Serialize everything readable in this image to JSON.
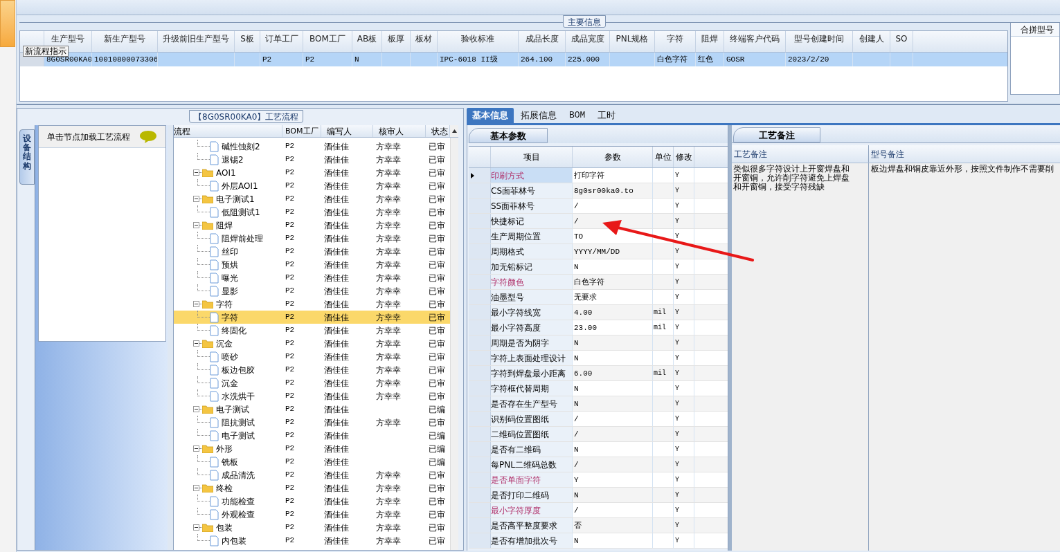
{
  "main_info": {
    "title": "主要信息",
    "columns": [
      "生产型号",
      "新生产型号",
      "升级前旧生产型号",
      "S板",
      "订单工厂",
      "BOM工厂",
      "AB板",
      "板厚",
      "板材",
      "验收标准",
      "成品长度",
      "成品宽度",
      "PNL规格",
      "字符",
      "阻焊",
      "终端客户代码",
      "型号创建时间",
      "创建人",
      "SO"
    ],
    "rows": [
      {
        "selected": true,
        "cells": [
          "8G0SR00KA0",
          "10010800073306",
          "",
          "",
          "P2",
          "P2",
          "N",
          "",
          "",
          "IPC-6018 II级",
          "264.100",
          "225.000",
          "",
          "白色字符",
          "红色",
          "GOSR",
          "2023/2/20",
          "",
          ""
        ]
      }
    ],
    "tooltip": "新流程指示",
    "side_title": "合拼型号"
  },
  "flow": {
    "title": "【8G0SR00KA0】工艺流程",
    "side_tab": "设备结构",
    "hint": "单击节点加载工艺流程",
    "columns": [
      "流程",
      "BOM工厂",
      "编写人",
      "核审人",
      "状态"
    ],
    "tree": [
      {
        "children": [
          {
            "name": "碱性蚀刻2",
            "bom": "P2",
            "writer": "酒佳佳",
            "reviewer": "方幸幸",
            "status": "已审",
            "selected": false
          },
          {
            "name": "退锡2",
            "bom": "P2",
            "writer": "酒佳佳",
            "reviewer": "方幸幸",
            "status": "已审",
            "selected": false
          }
        ]
      },
      {
        "name": "AOI1",
        "bom": "P2",
        "writer": "酒佳佳",
        "reviewer": "方幸幸",
        "status": "已审",
        "selected": false,
        "children": [
          {
            "name": "外层AOI1",
            "bom": "P2",
            "writer": "酒佳佳",
            "reviewer": "方幸幸",
            "status": "已审",
            "selected": false
          }
        ]
      },
      {
        "name": "电子测试1",
        "bom": "P2",
        "writer": "酒佳佳",
        "reviewer": "方幸幸",
        "status": "已审",
        "selected": false,
        "children": [
          {
            "name": "低阻测试1",
            "bom": "P2",
            "writer": "酒佳佳",
            "reviewer": "方幸幸",
            "status": "已审",
            "selected": false
          }
        ]
      },
      {
        "name": "阻焊",
        "bom": "P2",
        "writer": "酒佳佳",
        "reviewer": "方幸幸",
        "status": "已审",
        "selected": false,
        "children": [
          {
            "name": "阻焊前处理",
            "bom": "P2",
            "writer": "酒佳佳",
            "reviewer": "方幸幸",
            "status": "已审",
            "selected": false
          },
          {
            "name": "丝印",
            "bom": "P2",
            "writer": "酒佳佳",
            "reviewer": "方幸幸",
            "status": "已审",
            "selected": false
          },
          {
            "name": "预烘",
            "bom": "P2",
            "writer": "酒佳佳",
            "reviewer": "方幸幸",
            "status": "已审",
            "selected": false
          },
          {
            "name": "曝光",
            "bom": "P2",
            "writer": "酒佳佳",
            "reviewer": "方幸幸",
            "status": "已审",
            "selected": false
          },
          {
            "name": "显影",
            "bom": "P2",
            "writer": "酒佳佳",
            "reviewer": "方幸幸",
            "status": "已审",
            "selected": false
          }
        ]
      },
      {
        "name": "字符",
        "bom": "P2",
        "writer": "酒佳佳",
        "reviewer": "方幸幸",
        "status": "已审",
        "selected": false,
        "children": [
          {
            "name": "字符",
            "bom": "P2",
            "writer": "酒佳佳",
            "reviewer": "方幸幸",
            "status": "已审",
            "selected": true
          },
          {
            "name": "终固化",
            "bom": "P2",
            "writer": "酒佳佳",
            "reviewer": "方幸幸",
            "status": "已审",
            "selected": false
          }
        ]
      },
      {
        "name": "沉金",
        "bom": "P2",
        "writer": "酒佳佳",
        "reviewer": "方幸幸",
        "status": "已审",
        "selected": false,
        "children": [
          {
            "name": "喷砂",
            "bom": "P2",
            "writer": "酒佳佳",
            "reviewer": "方幸幸",
            "status": "已审",
            "selected": false
          },
          {
            "name": "板边包胶",
            "bom": "P2",
            "writer": "酒佳佳",
            "reviewer": "方幸幸",
            "status": "已审",
            "selected": false
          },
          {
            "name": "沉金",
            "bom": "P2",
            "writer": "酒佳佳",
            "reviewer": "方幸幸",
            "status": "已审",
            "selected": false
          },
          {
            "name": "水洗烘干",
            "bom": "P2",
            "writer": "酒佳佳",
            "reviewer": "方幸幸",
            "status": "已审",
            "selected": false
          }
        ]
      },
      {
        "name": "电子测试",
        "bom": "P2",
        "writer": "酒佳佳",
        "status": "已编",
        "selected": false,
        "children": [
          {
            "name": "阻抗测试",
            "bom": "P2",
            "writer": "酒佳佳",
            "reviewer": "方幸幸",
            "status": "已审",
            "selected": false
          },
          {
            "name": "电子测试",
            "bom": "P2",
            "writer": "酒佳佳",
            "status": "已编",
            "selected": false
          }
        ]
      },
      {
        "name": "外形",
        "bom": "P2",
        "writer": "酒佳佳",
        "status": "已编",
        "selected": false,
        "children": [
          {
            "name": "铣板",
            "bom": "P2",
            "writer": "酒佳佳",
            "status": "已编",
            "selected": false
          },
          {
            "name": "成品清洗",
            "bom": "P2",
            "writer": "酒佳佳",
            "reviewer": "方幸幸",
            "status": "已审",
            "selected": false
          }
        ]
      },
      {
        "name": "终检",
        "bom": "P2",
        "writer": "酒佳佳",
        "reviewer": "方幸幸",
        "status": "已审",
        "selected": false,
        "children": [
          {
            "name": "功能检查",
            "bom": "P2",
            "writer": "酒佳佳",
            "reviewer": "方幸幸",
            "status": "已审",
            "selected": false
          },
          {
            "name": "外观检查",
            "bom": "P2",
            "writer": "酒佳佳",
            "reviewer": "方幸幸",
            "status": "已审",
            "selected": false
          }
        ]
      },
      {
        "name": "包装",
        "bom": "P2",
        "writer": "酒佳佳",
        "reviewer": "方幸幸",
        "status": "已审",
        "selected": false,
        "children": [
          {
            "name": "内包装",
            "bom": "P2",
            "writer": "酒佳佳",
            "reviewer": "方幸幸",
            "status": "已审",
            "selected": false
          }
        ]
      }
    ]
  },
  "detail_tabs": [
    {
      "label": "基本信息",
      "selected": true
    },
    {
      "label": "拓展信息",
      "selected": false
    },
    {
      "label": "BOM",
      "selected": false
    },
    {
      "label": "工时",
      "selected": false
    }
  ],
  "params": {
    "tab": "基本参数",
    "columns": [
      "项目",
      "参数",
      "单位",
      "修改"
    ],
    "rows": [
      {
        "name": "印刷方式",
        "value": "打印字符",
        "unit": "",
        "modify": "Y",
        "highlighted": true,
        "selected": true
      },
      {
        "name": "CS面菲林号",
        "value": "8g0sr00ka0.to",
        "unit": "",
        "modify": "Y",
        "highlighted": false,
        "selected": false
      },
      {
        "name": "SS面菲林号",
        "value": "/",
        "unit": "",
        "modify": "Y",
        "highlighted": false,
        "selected": false
      },
      {
        "name": "快捷标记",
        "value": "/",
        "unit": "",
        "modify": "Y",
        "highlighted": false,
        "selected": false
      },
      {
        "name": "生产周期位置",
        "value": "TO",
        "unit": "",
        "modify": "Y",
        "highlighted": false,
        "selected": false
      },
      {
        "name": "周期格式",
        "value": "YYYY/MM/DD",
        "unit": "",
        "modify": "Y",
        "highlighted": false,
        "selected": false
      },
      {
        "name": "加无铅标记",
        "value": "N",
        "unit": "",
        "modify": "Y",
        "highlighted": false,
        "selected": false
      },
      {
        "name": "字符颜色",
        "value": "白色字符",
        "unit": "",
        "modify": "Y",
        "highlighted": true,
        "selected": false
      },
      {
        "name": "油墨型号",
        "value": "无要求",
        "unit": "",
        "modify": "Y",
        "highlighted": false,
        "selected": false
      },
      {
        "name": "最小字符线宽",
        "value": "4.00",
        "unit": "mil",
        "modify": "Y",
        "highlighted": false,
        "selected": false
      },
      {
        "name": "最小字符高度",
        "value": "23.00",
        "unit": "mil",
        "modify": "Y",
        "highlighted": false,
        "selected": false
      },
      {
        "name": "周期是否为阴字",
        "value": "N",
        "unit": "",
        "modify": "Y",
        "highlighted": false,
        "selected": false
      },
      {
        "name": "字符上表面处理设计",
        "value": "N",
        "unit": "",
        "modify": "Y",
        "highlighted": false,
        "selected": false
      },
      {
        "name": "字符到焊盘最小距离",
        "value": "6.00",
        "unit": "mil",
        "modify": "Y",
        "highlighted": false,
        "selected": false
      },
      {
        "name": "字符框代替周期",
        "value": "N",
        "unit": "",
        "modify": "Y",
        "highlighted": false,
        "selected": false
      },
      {
        "name": "是否存在生产型号",
        "value": "N",
        "unit": "",
        "modify": "Y",
        "highlighted": false,
        "selected": false
      },
      {
        "name": "识别码位置图纸",
        "value": "/",
        "unit": "",
        "modify": "Y",
        "highlighted": false,
        "selected": false
      },
      {
        "name": "二维码位置图纸",
        "value": "/",
        "unit": "",
        "modify": "Y",
        "highlighted": false,
        "selected": false
      },
      {
        "name": "是否有二维码",
        "value": "N",
        "unit": "",
        "modify": "Y",
        "highlighted": false,
        "selected": false
      },
      {
        "name": "每PNL二维码总数",
        "value": "/",
        "unit": "",
        "modify": "Y",
        "highlighted": false,
        "selected": false
      },
      {
        "name": "是否单面字符",
        "value": "Y",
        "unit": "",
        "modify": "Y",
        "highlighted": true,
        "selected": false
      },
      {
        "name": "是否打印二维码",
        "value": "N",
        "unit": "",
        "modify": "Y",
        "highlighted": false,
        "selected": false
      },
      {
        "name": "最小字符厚度",
        "value": "/",
        "unit": "",
        "modify": "Y",
        "highlighted": true,
        "selected": false
      },
      {
        "name": "是否高平整度要求",
        "value": "否",
        "unit": "",
        "modify": "Y",
        "highlighted": false,
        "selected": false
      },
      {
        "name": "是否有增加批次号",
        "value": "N",
        "unit": "",
        "modify": "Y",
        "highlighted": false,
        "selected": false
      }
    ]
  },
  "notes": {
    "tab": "工艺备注",
    "columns": [
      "工艺备注",
      "型号备注"
    ],
    "process_note": "类似很多字符设计上开窗焊盘和开窗铜，允许削字符避免上焊盘和开窗铜，接受字符残缺",
    "model_note": "板边焊盘和铜皮靠近外形，按照文件制作不需要削"
  }
}
